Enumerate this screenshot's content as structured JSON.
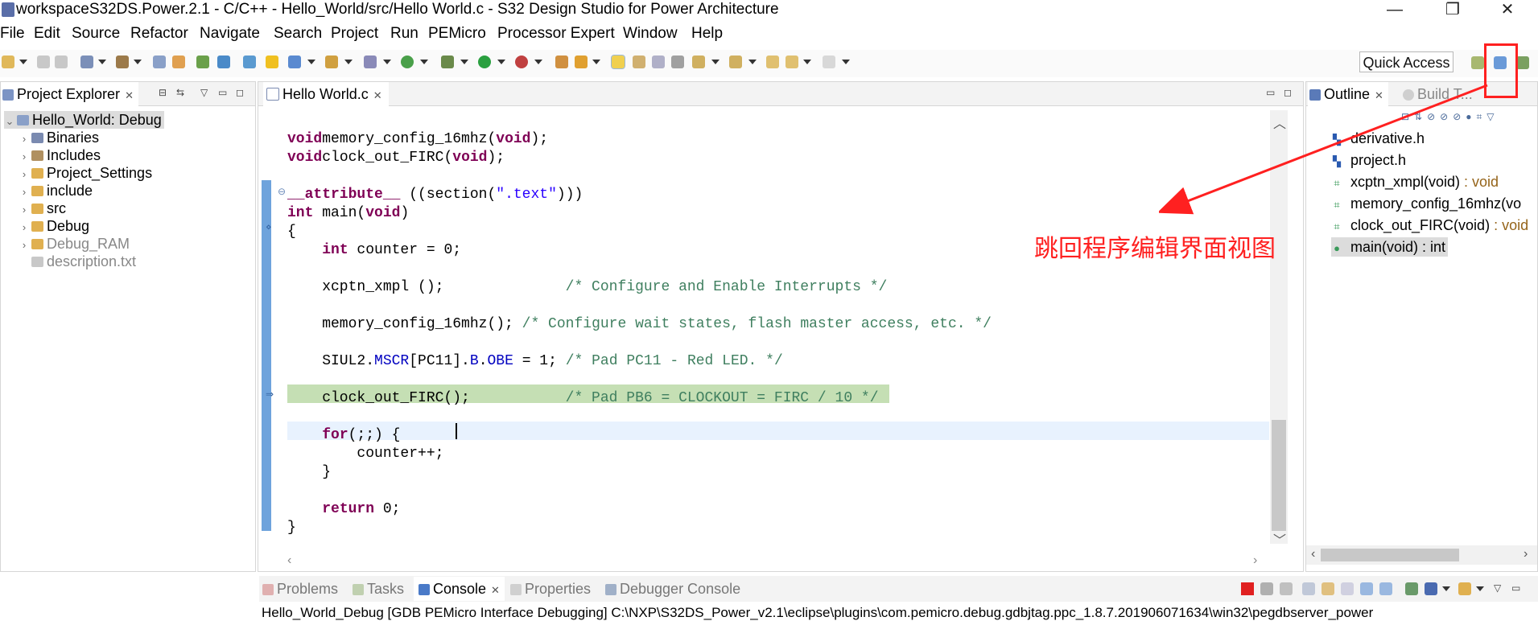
{
  "window": {
    "title": "workspaceS32DS.Power.2.1 - C/C++ - Hello_World/src/Hello World.c - S32 Design Studio for Power Architecture",
    "minimize_glyph": "—",
    "restore_glyph": "❐",
    "close_glyph": "✕"
  },
  "menu": [
    "File",
    "Edit",
    "Source",
    "Refactor",
    "Navigate",
    "Search",
    "Project",
    "Run",
    "PEMicro",
    "Processor Expert",
    "Window",
    "Help"
  ],
  "toolbar": {
    "quick_access": "Quick Access"
  },
  "project_explorer": {
    "tab_label": "Project Explorer",
    "items": [
      {
        "label": "Hello_World: Debug",
        "icon": "project-icon",
        "twisty": "⌄"
      },
      {
        "label": "Binaries",
        "icon": "binaries-icon",
        "twisty": "›"
      },
      {
        "label": "Includes",
        "icon": "includes-icon",
        "twisty": "›"
      },
      {
        "label": "Project_Settings",
        "icon": "folder-icon",
        "twisty": "›"
      },
      {
        "label": "include",
        "icon": "folder-icon",
        "twisty": "›"
      },
      {
        "label": "src",
        "icon": "folder-icon",
        "twisty": "›"
      },
      {
        "label": "Debug",
        "icon": "folder-icon",
        "twisty": "›"
      },
      {
        "label": "Debug_RAM",
        "icon": "folder-icon",
        "twisty": "›"
      },
      {
        "label": "description.txt",
        "icon": "text-file-icon",
        "twisty": ""
      }
    ]
  },
  "editor": {
    "tab_label": "Hello World.c",
    "lines": [
      {
        "segs": [
          [
            "kw",
            "void"
          ],
          [
            "",
            "memory_config_16mhz"
          ],
          [
            "",
            "("
          ],
          [
            "kw",
            "void"
          ],
          [
            "",
            ");"
          ]
        ]
      },
      {
        "segs": [
          [
            "kw",
            "void"
          ],
          [
            "",
            "clock_out_FIRC"
          ],
          [
            "",
            "("
          ],
          [
            "kw",
            "void"
          ],
          [
            "",
            ");"
          ]
        ]
      },
      {
        "segs": []
      },
      {
        "segs": [
          [
            "kw",
            "__attribute__"
          ],
          [
            "",
            " ((section("
          ],
          [
            "str",
            "\".text\""
          ],
          [
            "",
            ")))"
          ]
        ]
      },
      {
        "segs": [
          [
            "kw",
            "int"
          ],
          [
            "",
            " main("
          ],
          [
            "kw",
            "void"
          ],
          [
            "",
            ")"
          ]
        ]
      },
      {
        "segs": [
          [
            "",
            "{"
          ]
        ]
      },
      {
        "segs": [
          [
            "",
            "    "
          ],
          [
            "kw",
            "int"
          ],
          [
            "",
            " counter = 0;"
          ]
        ]
      },
      {
        "segs": []
      },
      {
        "segs": [
          [
            "",
            "    xcptn_xmpl ();              "
          ],
          [
            "cm",
            "/* Configure and Enable Interrupts */"
          ]
        ]
      },
      {
        "segs": []
      },
      {
        "segs": [
          [
            "",
            "    memory_config_16mhz(); "
          ],
          [
            "cm",
            "/* Configure wait states, flash master access, etc. */"
          ]
        ]
      },
      {
        "segs": []
      },
      {
        "segs": [
          [
            "",
            "    SIUL2."
          ],
          [
            "fld",
            "MSCR"
          ],
          [
            "",
            "[PC11]."
          ],
          [
            "fld",
            "B"
          ],
          [
            "",
            "."
          ],
          [
            "fld",
            "OBE"
          ],
          [
            "",
            " = 1; "
          ],
          [
            "cm",
            "/* Pad PC11 - Red LED. */"
          ]
        ]
      },
      {
        "segs": []
      },
      {
        "segs": [
          [
            "",
            "    clock_out_FIRC();           "
          ],
          [
            "cm",
            "/* Pad PB6 = CLOCKOUT = FIRC / 10 */"
          ]
        ]
      },
      {
        "segs": []
      },
      {
        "segs": [
          [
            "",
            "    "
          ],
          [
            "kw",
            "for"
          ],
          [
            "",
            "(;;) {"
          ]
        ]
      },
      {
        "segs": [
          [
            "",
            "        counter++;"
          ]
        ]
      },
      {
        "segs": [
          [
            "",
            "    }"
          ]
        ]
      },
      {
        "segs": []
      },
      {
        "segs": [
          [
            "",
            "    "
          ],
          [
            "kw",
            "return"
          ],
          [
            "",
            " 0;"
          ]
        ]
      },
      {
        "segs": [
          [
            "",
            "}"
          ]
        ]
      }
    ]
  },
  "outline": {
    "tab_label": "Outline",
    "tab2_label": "Build T...",
    "items": [
      {
        "label": "derivative.h",
        "ret": "",
        "icon": "include-icon"
      },
      {
        "label": "project.h",
        "ret": "",
        "icon": "include-icon"
      },
      {
        "label": "xcptn_xmpl(void)",
        "ret": " : void",
        "icon": "function-icon"
      },
      {
        "label": "memory_config_16mhz(vo",
        "ret": "",
        "icon": "function-icon"
      },
      {
        "label": "clock_out_FIRC(void)",
        "ret": " : void",
        "icon": "function-icon"
      },
      {
        "label": "main(void) : int",
        "ret": "",
        "icon": "function-dot-icon"
      }
    ]
  },
  "annotation": {
    "text": "跳回程序编辑界面视图",
    "color": "#ff2020"
  },
  "bottom_panel": {
    "tabs": [
      "Problems",
      "Tasks",
      "Console",
      "Properties",
      "Debugger Console"
    ],
    "active_tab": "Console",
    "console_line": "Hello_World_Debug [GDB PEMicro Interface Debugging] C:\\NXP\\S32DS_Power_v2.1\\eclipse\\plugins\\com.pemicro.debug.gdbjtag.ppc_1.8.7.201906071634\\win32\\pegdbserver_power"
  }
}
